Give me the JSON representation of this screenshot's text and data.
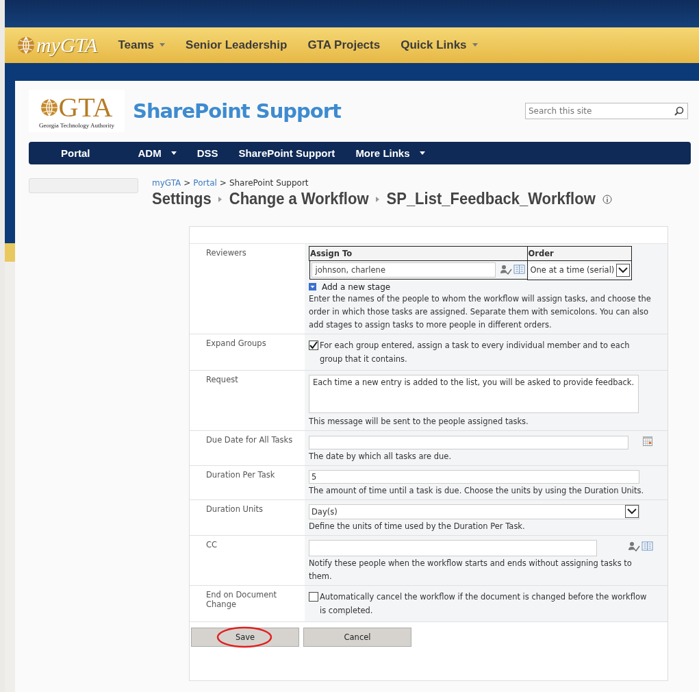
{
  "top_bar": {
    "logo": "myGTA",
    "nav": [
      {
        "label": "Teams",
        "has_menu": true
      },
      {
        "label": "Senior Leadership",
        "has_menu": false
      },
      {
        "label": "GTA Projects",
        "has_menu": false
      },
      {
        "label": "Quick Links",
        "has_menu": true
      }
    ]
  },
  "site_header": {
    "logo_text": "GTA",
    "logo_caption": "Georgia Technology Authority",
    "title": "SharePoint Support",
    "search": {
      "placeholder": "Search this site"
    }
  },
  "site_nav": [
    {
      "label": "Portal",
      "has_menu": false
    },
    {
      "label": "ADM",
      "has_menu": true
    },
    {
      "label": "DSS",
      "has_menu": false
    },
    {
      "label": "SharePoint Support",
      "has_menu": false
    },
    {
      "label": "More Links",
      "has_menu": true
    }
  ],
  "breadcrumb": [
    {
      "label": "myGTA",
      "link": true
    },
    {
      "separator": ">",
      "label": "Portal",
      "link": true
    },
    {
      "separator": ">",
      "label": "SharePoint Support",
      "link": false
    }
  ],
  "title_trail": [
    "Settings",
    "Change a Workflow",
    "SP_List_Feedback_Workflow"
  ],
  "form": {
    "rows": [
      {
        "kind": "reviewers",
        "label": "Reviewers",
        "columns": [
          "Assign To",
          "Order"
        ],
        "value": "johnson, charlene",
        "order": "One at a time (serial)",
        "add_stage": "Add a new stage",
        "help": "Enter the names of the people to whom the workflow will assign tasks, and choose the order in which those tasks are assigned. Separate them with semicolons. You can also add stages to assign tasks to more people in different orders."
      },
      {
        "kind": "checkbox",
        "label": "Expand Groups",
        "checked": true,
        "text": "For each group entered, assign a task to every individual member and to each group that it contains."
      },
      {
        "kind": "textarea",
        "label": "Request",
        "value": "Each time a new entry is added to the list, you will be asked to provide feedback.",
        "help": "This message will be sent to the people assigned tasks."
      },
      {
        "kind": "date",
        "label": "Due Date for All Tasks",
        "help": "The date by which all tasks are due."
      },
      {
        "kind": "text",
        "label": "Duration Per Task",
        "value": "5",
        "help": "The amount of time until a task is due. Choose the units by using the Duration Units."
      },
      {
        "kind": "select",
        "label": "Duration Units",
        "value": "Day(s)",
        "help": "Define the units of time used by the Duration Per Task."
      },
      {
        "kind": "people",
        "label": "CC",
        "help": "Notify these people when the workflow starts and ends without assigning tasks to them."
      },
      {
        "kind": "checkbox",
        "label": "End on Document Change",
        "checked": false,
        "text": "Automatically cancel the workflow if the document is changed before the workflow is completed."
      }
    ],
    "buttons": [
      {
        "label": "Save",
        "highlighted": true
      },
      {
        "label": "Cancel",
        "highlighted": false
      }
    ]
  }
}
